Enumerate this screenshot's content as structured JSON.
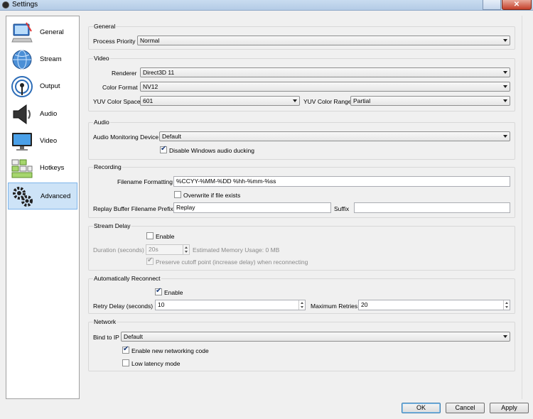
{
  "window": {
    "title": "Settings"
  },
  "sidebar": {
    "items": [
      {
        "label": "General",
        "icon": "general-icon",
        "active": false
      },
      {
        "label": "Stream",
        "icon": "stream-icon",
        "active": false
      },
      {
        "label": "Output",
        "icon": "output-icon",
        "active": false
      },
      {
        "label": "Audio",
        "icon": "audio-icon",
        "active": false
      },
      {
        "label": "Video",
        "icon": "video-icon",
        "active": false
      },
      {
        "label": "Hotkeys",
        "icon": "hotkeys-icon",
        "active": false
      },
      {
        "label": "Advanced",
        "icon": "advanced-icon",
        "active": true
      }
    ]
  },
  "general": {
    "title": "General",
    "process_priority_label": "Process Priority",
    "process_priority_value": "Normal"
  },
  "video": {
    "title": "Video",
    "renderer_label": "Renderer",
    "renderer_value": "Direct3D 11",
    "color_format_label": "Color Format",
    "color_format_value": "NV12",
    "yuv_color_space_label": "YUV Color Space",
    "yuv_color_space_value": "601",
    "yuv_color_range_label": "YUV Color Range",
    "yuv_color_range_value": "Partial"
  },
  "audio": {
    "title": "Audio",
    "monitoring_device_label": "Audio Monitoring Device",
    "monitoring_device_value": "Default",
    "disable_ducking_label": "Disable Windows audio ducking",
    "disable_ducking_checked": true
  },
  "recording": {
    "title": "Recording",
    "filename_formatting_label": "Filename Formatting",
    "filename_formatting_value": "%CCYY-%MM-%DD %hh-%mm-%ss",
    "overwrite_label": "Overwrite if file exists",
    "overwrite_checked": false,
    "replay_prefix_label": "Replay Buffer Filename Prefix",
    "replay_prefix_value": "Replay",
    "suffix_label": "Suffix",
    "suffix_value": ""
  },
  "stream_delay": {
    "title": "Stream Delay",
    "enable_label": "Enable",
    "enable_checked": false,
    "duration_label": "Duration (seconds)",
    "duration_value": "20s",
    "memory_usage_label": "Estimated Memory Usage: 0 MB",
    "preserve_label": "Preserve cutoff point (increase delay) when reconnecting",
    "preserve_checked": true
  },
  "auto_reconnect": {
    "title": "Automatically Reconnect",
    "enable_label": "Enable",
    "enable_checked": true,
    "retry_delay_label": "Retry Delay (seconds)",
    "retry_delay_value": "10",
    "max_retries_label": "Maximum Retries",
    "max_retries_value": "20"
  },
  "network": {
    "title": "Network",
    "bind_ip_label": "Bind to IP",
    "bind_ip_value": "Default",
    "new_networking_label": "Enable new networking code",
    "new_networking_checked": true,
    "low_latency_label": "Low latency mode",
    "low_latency_checked": false
  },
  "buttons": {
    "ok": "OK",
    "cancel": "Cancel",
    "apply": "Apply"
  }
}
